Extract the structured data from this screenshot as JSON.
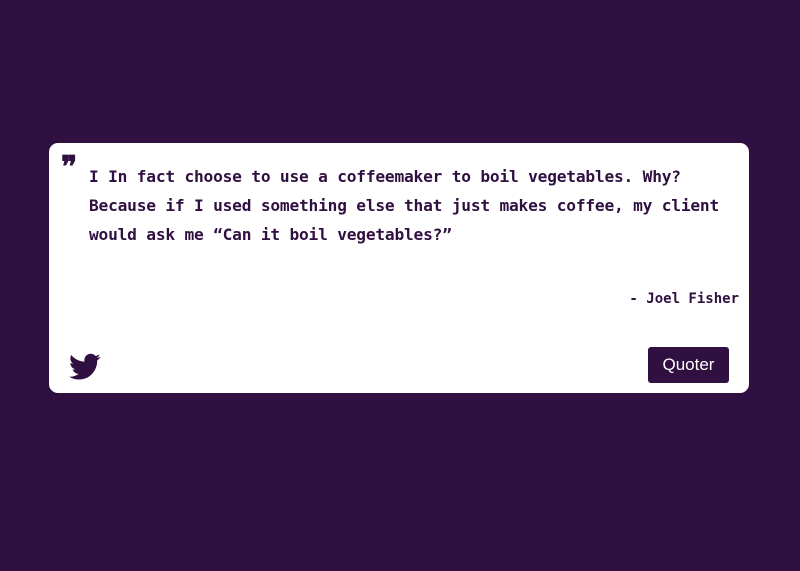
{
  "quote": {
    "mark": "❞",
    "text": "I In fact choose to use a coffeemaker to boil vegetables. Why? Because if I used something else that just makes coffee, my client would ask me “Can it boil vegetables?”",
    "author": "- Joel Fisher"
  },
  "actions": {
    "tweet_icon": "twitter-bird-icon",
    "new_quote_label": "Quoter"
  },
  "colors": {
    "background": "#301040",
    "card": "#ffffff",
    "accent": "#301040"
  }
}
